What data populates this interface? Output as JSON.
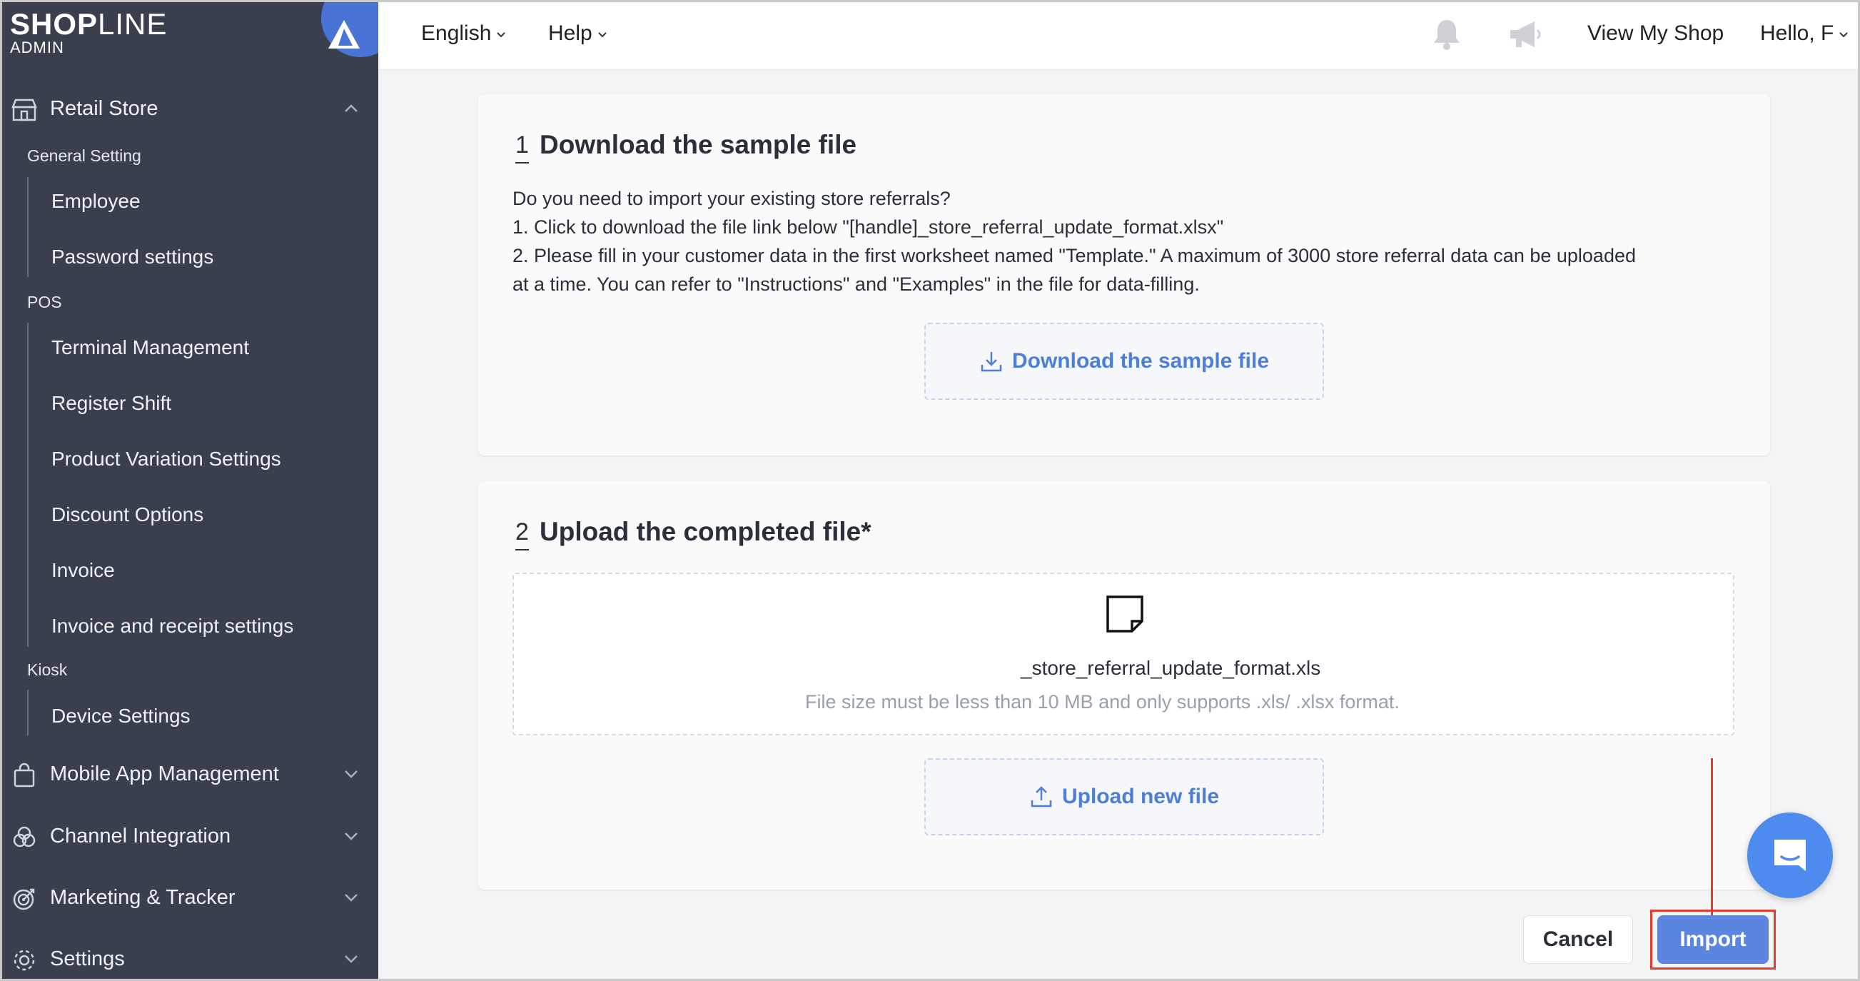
{
  "brand": {
    "logo_bold": "SHOP",
    "logo_thin": "LINE",
    "sub": "ADMIN"
  },
  "sidebar": {
    "retail_store": "Retail Store",
    "general_setting": "General Setting",
    "general_items": [
      "Employee",
      "Password settings"
    ],
    "pos": "POS",
    "pos_items": [
      "Terminal Management",
      "Register Shift",
      "Product Variation Settings",
      "Discount Options",
      "Invoice",
      "Invoice and receipt settings"
    ],
    "kiosk": "Kiosk",
    "kiosk_items": [
      "Device Settings"
    ],
    "mobile_app": "Mobile App Management",
    "channel": "Channel Integration",
    "marketing": "Marketing & Tracker",
    "settings": "Settings"
  },
  "topbar": {
    "language": "English",
    "help": "Help",
    "view_shop": "View My Shop",
    "greeting": "Hello, F"
  },
  "step1": {
    "number": "1",
    "title": "Download the sample file",
    "line1": "Do you need to import your existing store referrals?",
    "line2": "1. Click to download the file link below \"[handle]_store_referral_update_format.xlsx\"",
    "line3": "2. Please fill in your customer data in the first worksheet named \"Template.\" A maximum of 3000 store referral data can be uploaded",
    "line4": "at a time. You can refer to \"Instructions\" and \"Examples\" in the file for data-filling.",
    "button": "Download the sample file"
  },
  "step2": {
    "number": "2",
    "title": "Upload the completed file*",
    "file_name": "_store_referral_update_format.xls",
    "hint": "File size must be less than 10 MB and only supports .xls/ .xlsx format.",
    "button": "Upload new file"
  },
  "actions": {
    "cancel": "Cancel",
    "import": "Import"
  },
  "colors": {
    "sidebar": "#3a3f4e",
    "accent": "#5b86e0",
    "highlight": "#e53a2c"
  }
}
